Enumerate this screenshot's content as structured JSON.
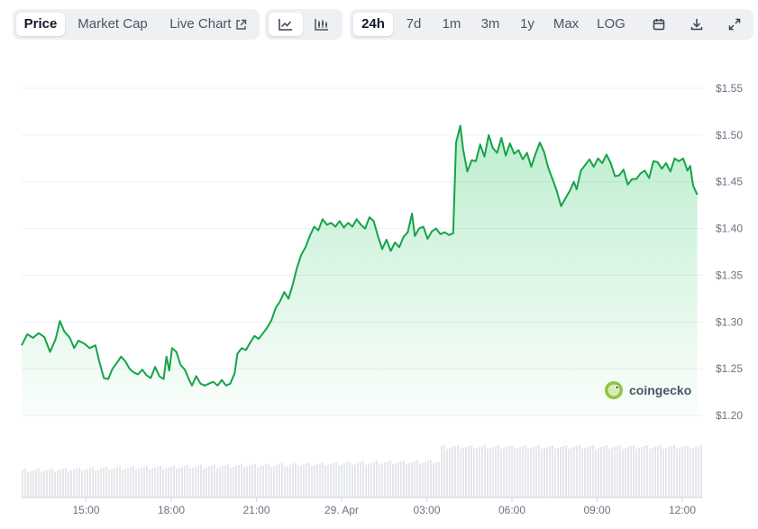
{
  "toolbar": {
    "tabs": [
      "Price",
      "Market Cap",
      "Live Chart"
    ],
    "active_tab": "Price",
    "chart_modes": [
      "line-chart-icon",
      "candlestick-icon"
    ],
    "ranges": [
      "24h",
      "7d",
      "1m",
      "3m",
      "1y",
      "Max",
      "LOG"
    ],
    "active_range": "24h",
    "actions": [
      "calendar-icon",
      "download-icon",
      "expand-icon"
    ]
  },
  "watermark": "coingecko",
  "colors": {
    "line": "#16a34a",
    "fill": "#22c55e",
    "volume": "#e5e7eb",
    "grid": "#eef0f3"
  },
  "chart_data": {
    "type": "area",
    "x_ticks": [
      "15:00",
      "18:00",
      "21:00",
      "29. Apr",
      "03:00",
      "06:00",
      "09:00",
      "12:00"
    ],
    "y_ticks": [
      "$1.55",
      "$1.50",
      "$1.45",
      "$1.40",
      "$1.35",
      "$1.30",
      "$1.25",
      "$1.20"
    ],
    "ylim": [
      1.2,
      1.55
    ],
    "x_range_hours": [
      0,
      24
    ],
    "x_tick_hours": [
      2.27,
      5.27,
      8.27,
      11.27,
      14.27,
      17.27,
      20.27,
      23.27
    ],
    "series": [
      {
        "values": [
          [
            0.0,
            1.275
          ],
          [
            0.2,
            1.287
          ],
          [
            0.4,
            1.283
          ],
          [
            0.6,
            1.288
          ],
          [
            0.8,
            1.284
          ],
          [
            1.0,
            1.268
          ],
          [
            1.2,
            1.282
          ],
          [
            1.35,
            1.301
          ],
          [
            1.5,
            1.29
          ],
          [
            1.7,
            1.283
          ],
          [
            1.85,
            1.272
          ],
          [
            2.0,
            1.28
          ],
          [
            2.2,
            1.277
          ],
          [
            2.4,
            1.272
          ],
          [
            2.6,
            1.275
          ],
          [
            2.75,
            1.256
          ],
          [
            2.9,
            1.24
          ],
          [
            3.05,
            1.239
          ],
          [
            3.2,
            1.25
          ],
          [
            3.35,
            1.256
          ],
          [
            3.5,
            1.263
          ],
          [
            3.65,
            1.258
          ],
          [
            3.8,
            1.25
          ],
          [
            3.95,
            1.246
          ],
          [
            4.1,
            1.244
          ],
          [
            4.25,
            1.249
          ],
          [
            4.4,
            1.243
          ],
          [
            4.55,
            1.24
          ],
          [
            4.7,
            1.252
          ],
          [
            4.85,
            1.242
          ],
          [
            5.0,
            1.239
          ],
          [
            5.1,
            1.263
          ],
          [
            5.2,
            1.248
          ],
          [
            5.3,
            1.272
          ],
          [
            5.45,
            1.268
          ],
          [
            5.6,
            1.254
          ],
          [
            5.75,
            1.249
          ],
          [
            5.9,
            1.238
          ],
          [
            6.0,
            1.232
          ],
          [
            6.15,
            1.242
          ],
          [
            6.3,
            1.234
          ],
          [
            6.45,
            1.232
          ],
          [
            6.6,
            1.234
          ],
          [
            6.75,
            1.236
          ],
          [
            6.9,
            1.232
          ],
          [
            7.05,
            1.238
          ],
          [
            7.2,
            1.232
          ],
          [
            7.35,
            1.234
          ],
          [
            7.5,
            1.245
          ],
          [
            7.6,
            1.266
          ],
          [
            7.75,
            1.272
          ],
          [
            7.9,
            1.27
          ],
          [
            8.05,
            1.278
          ],
          [
            8.2,
            1.285
          ],
          [
            8.35,
            1.282
          ],
          [
            8.5,
            1.288
          ],
          [
            8.65,
            1.294
          ],
          [
            8.8,
            1.302
          ],
          [
            8.95,
            1.315
          ],
          [
            9.1,
            1.322
          ],
          [
            9.25,
            1.332
          ],
          [
            9.4,
            1.325
          ],
          [
            9.55,
            1.34
          ],
          [
            9.7,
            1.358
          ],
          [
            9.85,
            1.372
          ],
          [
            10.0,
            1.38
          ],
          [
            10.15,
            1.392
          ],
          [
            10.3,
            1.402
          ],
          [
            10.45,
            1.398
          ],
          [
            10.6,
            1.41
          ],
          [
            10.75,
            1.404
          ],
          [
            10.9,
            1.406
          ],
          [
            11.05,
            1.402
          ],
          [
            11.2,
            1.408
          ],
          [
            11.35,
            1.401
          ],
          [
            11.5,
            1.406
          ],
          [
            11.65,
            1.402
          ],
          [
            11.8,
            1.41
          ],
          [
            11.95,
            1.404
          ],
          [
            12.1,
            1.4
          ],
          [
            12.25,
            1.412
          ],
          [
            12.4,
            1.408
          ],
          [
            12.55,
            1.392
          ],
          [
            12.7,
            1.378
          ],
          [
            12.85,
            1.388
          ],
          [
            13.0,
            1.376
          ],
          [
            13.15,
            1.385
          ],
          [
            13.3,
            1.38
          ],
          [
            13.45,
            1.391
          ],
          [
            13.6,
            1.396
          ],
          [
            13.75,
            1.416
          ],
          [
            13.85,
            1.392
          ],
          [
            14.0,
            1.4
          ],
          [
            14.15,
            1.402
          ],
          [
            14.3,
            1.389
          ],
          [
            14.45,
            1.397
          ],
          [
            14.6,
            1.4
          ],
          [
            14.75,
            1.394
          ],
          [
            14.9,
            1.396
          ],
          [
            15.05,
            1.393
          ],
          [
            15.2,
            1.395
          ],
          [
            15.3,
            1.492
          ],
          [
            15.45,
            1.51
          ],
          [
            15.55,
            1.485
          ],
          [
            15.7,
            1.461
          ],
          [
            15.85,
            1.473
          ],
          [
            16.0,
            1.472
          ],
          [
            16.15,
            1.49
          ],
          [
            16.3,
            1.477
          ],
          [
            16.45,
            1.5
          ],
          [
            16.6,
            1.486
          ],
          [
            16.75,
            1.481
          ],
          [
            16.9,
            1.497
          ],
          [
            17.05,
            1.478
          ],
          [
            17.2,
            1.491
          ],
          [
            17.35,
            1.48
          ],
          [
            17.5,
            1.484
          ],
          [
            17.65,
            1.474
          ],
          [
            17.8,
            1.481
          ],
          [
            17.95,
            1.466
          ],
          [
            18.1,
            1.48
          ],
          [
            18.25,
            1.492
          ],
          [
            18.4,
            1.482
          ],
          [
            18.55,
            1.465
          ],
          [
            18.7,
            1.453
          ],
          [
            18.85,
            1.44
          ],
          [
            19.0,
            1.424
          ],
          [
            19.15,
            1.432
          ],
          [
            19.3,
            1.44
          ],
          [
            19.45,
            1.45
          ],
          [
            19.55,
            1.442
          ],
          [
            19.7,
            1.462
          ],
          [
            19.85,
            1.468
          ],
          [
            20.0,
            1.474
          ],
          [
            20.15,
            1.466
          ],
          [
            20.3,
            1.475
          ],
          [
            20.45,
            1.47
          ],
          [
            20.6,
            1.479
          ],
          [
            20.75,
            1.47
          ],
          [
            20.9,
            1.456
          ],
          [
            21.05,
            1.457
          ],
          [
            21.2,
            1.463
          ],
          [
            21.35,
            1.447
          ],
          [
            21.5,
            1.453
          ],
          [
            21.65,
            1.453
          ],
          [
            21.8,
            1.459
          ],
          [
            21.95,
            1.462
          ],
          [
            22.1,
            1.454
          ],
          [
            22.25,
            1.472
          ],
          [
            22.4,
            1.471
          ],
          [
            22.55,
            1.464
          ],
          [
            22.7,
            1.47
          ],
          [
            22.85,
            1.461
          ],
          [
            23.0,
            1.475
          ],
          [
            23.15,
            1.472
          ],
          [
            23.3,
            1.475
          ],
          [
            23.45,
            1.462
          ],
          [
            23.55,
            1.467
          ],
          [
            23.65,
            1.446
          ],
          [
            23.8,
            1.436
          ]
        ]
      }
    ],
    "grid": true
  }
}
